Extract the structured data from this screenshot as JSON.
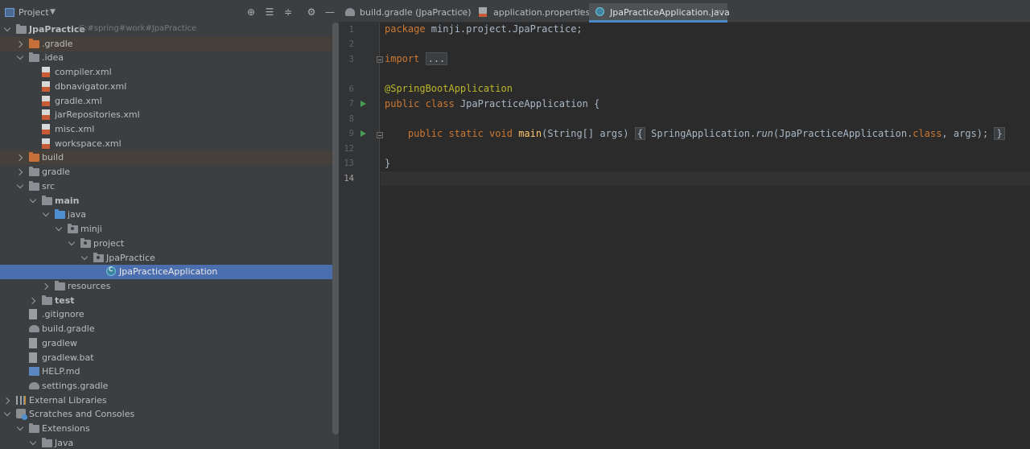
{
  "project_panel": {
    "title": "Project",
    "tree": [
      {
        "label": "JpaPractice",
        "hint": "C:#spring#work#JpaPractice",
        "depth": 0,
        "arrow": "open",
        "icon": "folder-module-icon",
        "bold": true
      },
      {
        "label": ".gradle",
        "depth": 1,
        "arrow": "closed",
        "icon": "folder-excluded-icon",
        "highlight": "orange"
      },
      {
        "label": ".idea",
        "depth": 1,
        "arrow": "open",
        "icon": "folder-icon"
      },
      {
        "label": "compiler.xml",
        "depth": 2,
        "icon": "xml-file-icon"
      },
      {
        "label": "dbnavigator.xml",
        "depth": 2,
        "icon": "xml-file-icon"
      },
      {
        "label": "gradle.xml",
        "depth": 2,
        "icon": "xml-file-icon"
      },
      {
        "label": "jarRepositories.xml",
        "depth": 2,
        "icon": "xml-file-icon"
      },
      {
        "label": "misc.xml",
        "depth": 2,
        "icon": "xml-file-icon"
      },
      {
        "label": "workspace.xml",
        "depth": 2,
        "icon": "xml-file-icon"
      },
      {
        "label": "build",
        "depth": 1,
        "arrow": "closed",
        "icon": "folder-excluded-icon",
        "highlight": "orange"
      },
      {
        "label": "gradle",
        "depth": 1,
        "arrow": "closed",
        "icon": "folder-icon"
      },
      {
        "label": "src",
        "depth": 1,
        "arrow": "open",
        "icon": "folder-icon"
      },
      {
        "label": "main",
        "depth": 2,
        "arrow": "open",
        "icon": "folder-icon",
        "bold": true
      },
      {
        "label": "java",
        "depth": 3,
        "arrow": "open",
        "icon": "folder-source-icon"
      },
      {
        "label": "minji",
        "depth": 4,
        "arrow": "open",
        "icon": "package-icon"
      },
      {
        "label": "project",
        "depth": 5,
        "arrow": "open",
        "icon": "package-icon"
      },
      {
        "label": "JpaPractice",
        "depth": 6,
        "arrow": "open",
        "icon": "package-icon"
      },
      {
        "label": "JpaPracticeApplication",
        "depth": 7,
        "icon": "java-class-icon",
        "selected": true
      },
      {
        "label": "resources",
        "depth": 3,
        "arrow": "closed",
        "icon": "folder-resources-icon"
      },
      {
        "label": "test",
        "depth": 2,
        "arrow": "closed",
        "icon": "folder-icon",
        "bold": true
      },
      {
        "label": ".gitignore",
        "depth": 1,
        "icon": "text-file-icon"
      },
      {
        "label": "build.gradle",
        "depth": 1,
        "icon": "gradle-file-icon"
      },
      {
        "label": "gradlew",
        "depth": 1,
        "icon": "text-file-icon"
      },
      {
        "label": "gradlew.bat",
        "depth": 1,
        "icon": "text-file-icon"
      },
      {
        "label": "HELP.md",
        "depth": 1,
        "icon": "markdown-file-icon"
      },
      {
        "label": "settings.gradle",
        "depth": 1,
        "icon": "gradle-file-icon"
      },
      {
        "label": "External Libraries",
        "depth": 0,
        "arrow": "closed",
        "icon": "libraries-icon"
      },
      {
        "label": "Scratches and Consoles",
        "depth": 0,
        "arrow": "open",
        "icon": "scratches-icon"
      },
      {
        "label": "Extensions",
        "depth": 1,
        "arrow": "open",
        "icon": "folder-icon"
      },
      {
        "label": "Java",
        "depth": 2,
        "arrow": "open",
        "icon": "folder-icon"
      }
    ]
  },
  "editor": {
    "tabs": [
      {
        "label": "build.gradle (JpaPractice)",
        "icon": "gradle-file-icon",
        "active": false
      },
      {
        "label": "application.properties",
        "icon": "properties-file-icon",
        "active": false
      },
      {
        "label": "JpaPracticeApplication.java",
        "icon": "java-class-icon",
        "active": true
      }
    ],
    "line_numbers": [
      "1",
      "2",
      "3",
      "6",
      "7",
      "8",
      "9",
      "12",
      "13",
      "14"
    ],
    "current_line": "14",
    "code": {
      "l1_kw": "package",
      "l1_rest": " minji.project.JpaPractice;",
      "l3_kw": "import",
      "l3_fold": "...",
      "l6_ann": "@SpringBootApplication",
      "l7_kw": "public class",
      "l7_rest": " JpaPracticeApplication {",
      "l9_kw": "public static void",
      "l9_fn": "main",
      "l9_params": "(String[] args)",
      "l9_open": "{",
      "l9_call1": " SpringApplication.",
      "l9_run": "run",
      "l9_call2": "(JpaPracticeApplication.",
      "l9_class_kw": "class",
      "l9_call3": ", args);",
      "l9_close": "}",
      "l13": "}"
    }
  }
}
